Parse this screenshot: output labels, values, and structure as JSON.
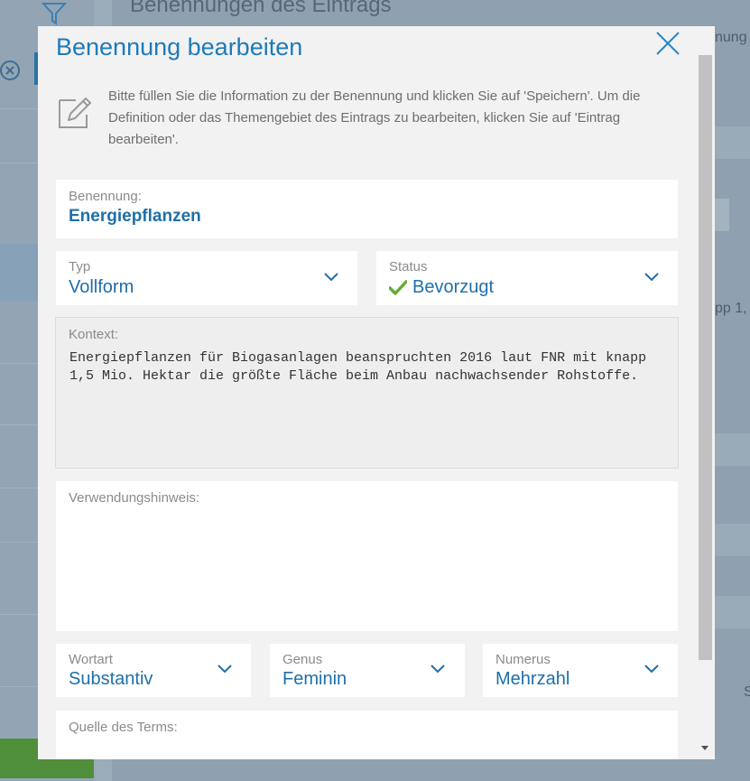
{
  "background": {
    "title": "Benennungen des Eintrags",
    "snippet_top_right": "nung",
    "snippet_mid_right": "pp 1,",
    "snippet_bottom_right": "S"
  },
  "modal": {
    "title": "Benennung bearbeiten",
    "info_text": "Bitte füllen Sie die Information zu der Benennung und klicken Sie auf 'Speichern'. Um die Definition oder das Themengebiet des Eintrags zu bearbeiten, klicken Sie auf 'Eintrag bearbeiten'.",
    "benennung": {
      "label": "Benennung:",
      "value": "Energiepflanzen"
    },
    "typ": {
      "label": "Typ",
      "value": "Vollform"
    },
    "status": {
      "label": "Status",
      "value": "Bevorzugt",
      "icon": "check-icon",
      "icon_color": "#6aaa3a"
    },
    "kontext": {
      "label": "Kontext:",
      "value": "Energiepflanzen für Biogasanlagen beanspruchten 2016 laut FNR mit knapp 1,5 Mio. Hektar die größte Fläche beim Anbau nachwachsender Rohstoffe."
    },
    "verwendungshinweis": {
      "label": "Verwendungshinweis:",
      "value": ""
    },
    "wortart": {
      "label": "Wortart",
      "value": "Substantiv"
    },
    "genus": {
      "label": "Genus",
      "value": "Feminin"
    },
    "numerus": {
      "label": "Numerus",
      "value": "Mehrzahl"
    },
    "quelle": {
      "label": "Quelle des Terms:",
      "value": ""
    }
  },
  "colors": {
    "accent": "#1f7ab8",
    "overlay": "#8fa1b0",
    "success": "#6aaa3a"
  }
}
